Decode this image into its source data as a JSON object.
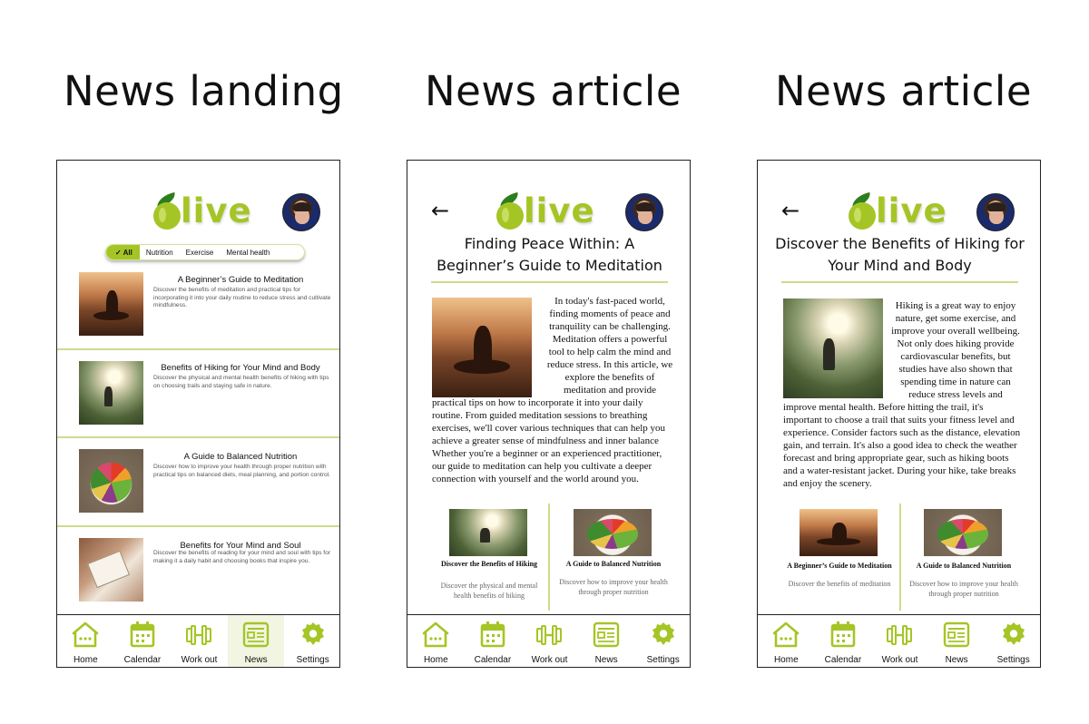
{
  "headings": [
    "News landing",
    "News article",
    "News article"
  ],
  "brand": {
    "name": "live",
    "accent": "#a5c526"
  },
  "filters": [
    "✓ All",
    "Nutrition",
    "Exercise",
    "Mental health"
  ],
  "landing_items": [
    {
      "title": "A Beginner’s Guide to Meditation",
      "desc": "Discover the benefits of meditation and practical tips for incorporating it into your daily routine to reduce stress and cultivate mindfulness."
    },
    {
      "title": "Benefits of Hiking for Your Mind and Body",
      "desc": "Discover the physical and mental health benefits of hiking with tips on choosing trails and staying safe in nature."
    },
    {
      "title": "A Guide to Balanced Nutrition",
      "desc": "Discover how to improve your health through proper nutrition with practical tips on balanced diets, meal planning, and portion control."
    },
    {
      "title": "Benefits for Your Mind and Soul",
      "desc": "Discover the benefits of reading for your mind and soul with tips for making it a daily habit and choosing books that inspire you."
    }
  ],
  "nav": [
    "Home",
    "Calendar",
    "Work out",
    "News",
    "Settings"
  ],
  "article1": {
    "title_line1": "Finding Peace Within: A",
    "title_line2": "Beginner’s Guide to Meditation",
    "wrap": [
      "In today's fast-paced world,",
      "finding moments of peace and",
      "tranquility can be challenging.",
      "Meditation offers a powerful",
      "tool to help calm the mind and",
      "reduce stress. In this article, we",
      "explore the  benefits of",
      "meditation and provide"
    ],
    "body": "practical tips on how to incorporate it into your daily routine. From guided meditation sessions to breathing exercises, we'll cover various techniques that can help you achieve a greater sense of mindfulness and inner balance Whether you're a beginner or an experienced practitioner, our guide to meditation can help you cultivate a deeper connection with yourself and the world around you.",
    "related": [
      {
        "title": "Discover the Benefits of Hiking",
        "desc": "Discover the physical and mental health benefits of hiking"
      },
      {
        "title": "A Guide to Balanced Nutrition",
        "desc": "Discover how to improve your health through proper nutrition"
      }
    ]
  },
  "article2": {
    "title_line1": "Discover the Benefits of Hiking for",
    "title_line2": "Your Mind and Body",
    "wrap": [
      "Hiking is a great way to enjoy",
      "nature, get some exercise, and",
      "improve your overall wellbeing.",
      "Not only does hiking provide",
      "cardiovascular benefits, but",
      "studies have also shown that",
      "spending time in nature can",
      "reduce stress levels and"
    ],
    "body": "improve mental health. Before hitting the trail, it's important to choose a trail that suits your fitness level and experience. Consider factors such as the distance, elevation gain, and terrain. It's also a good idea to check the weather forecast and bring appropriate gear, such as hiking boots and a water-resistant jacket. During your hike, take breaks and enjoy the scenery.",
    "related": [
      {
        "title": "A Beginner’s Guide to Meditation",
        "desc": "Discover the benefits of meditation"
      },
      {
        "title": "A Guide to Balanced Nutrition",
        "desc": "Discover how to improve your health through proper nutrition"
      }
    ]
  }
}
